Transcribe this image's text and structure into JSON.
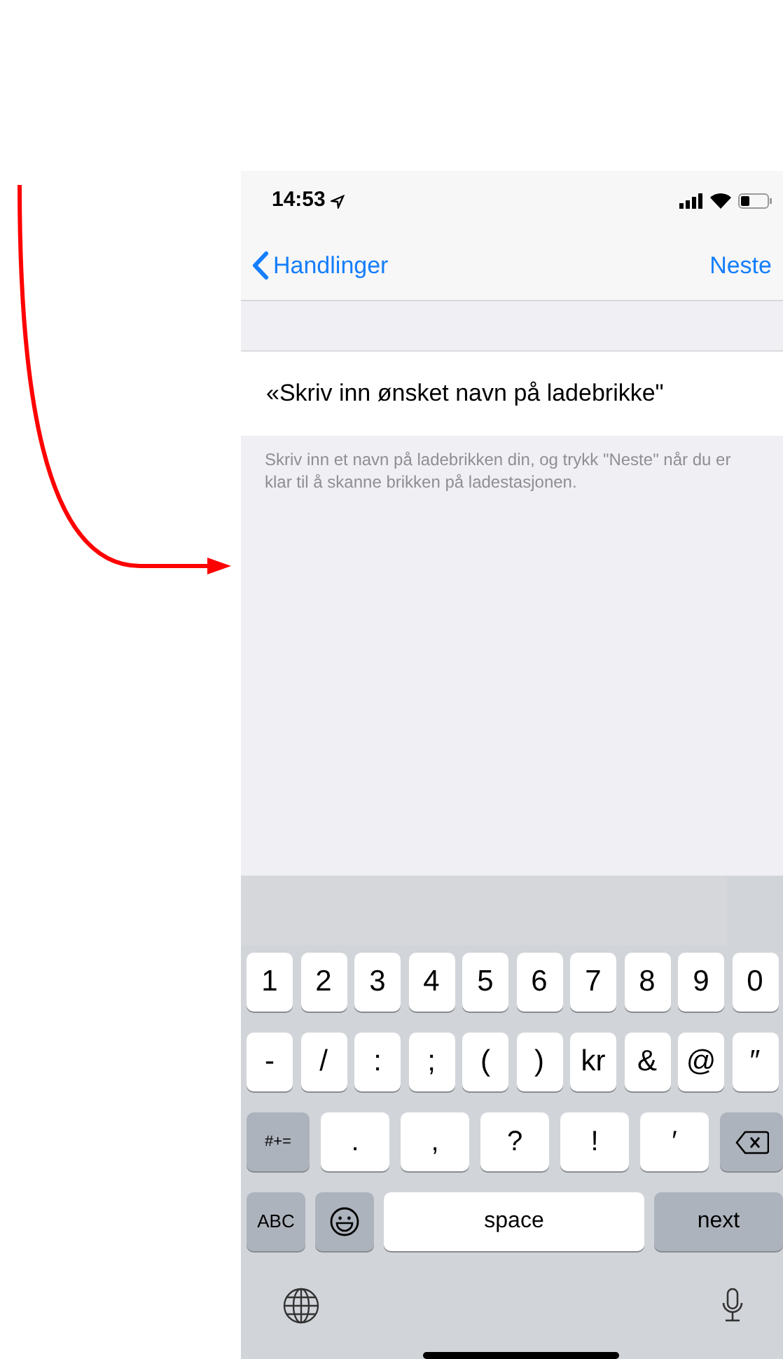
{
  "status_bar": {
    "time": "14:53"
  },
  "nav_bar": {
    "back_label": "Handlinger",
    "action": "Neste"
  },
  "name_field": {
    "value": "«Skriv inn ønsket navn på ladebrikke\""
  },
  "help_text": "Skriv inn et navn på ladebrikken din, og trykk \"Neste\" når du er klar til å skanne brikken på ladestasjonen.",
  "keyboard": {
    "rows": [
      {
        "keys": [
          {
            "kind": "char",
            "label": "1"
          },
          {
            "kind": "char",
            "label": "2"
          },
          {
            "kind": "char",
            "label": "3"
          },
          {
            "kind": "char",
            "label": "4"
          },
          {
            "kind": "char",
            "label": "5"
          },
          {
            "kind": "char",
            "label": "6"
          },
          {
            "kind": "char",
            "label": "7"
          },
          {
            "kind": "char",
            "label": "8"
          },
          {
            "kind": "char",
            "label": "9"
          },
          {
            "kind": "char",
            "label": "0"
          }
        ]
      },
      {
        "keys": [
          {
            "kind": "char",
            "label": "-"
          },
          {
            "kind": "char",
            "label": "/"
          },
          {
            "kind": "char",
            "label": ":"
          },
          {
            "kind": "char",
            "label": ";"
          },
          {
            "kind": "char",
            "label": "("
          },
          {
            "kind": "char",
            "label": ")"
          },
          {
            "kind": "char",
            "label": "kr"
          },
          {
            "kind": "char",
            "label": "&"
          },
          {
            "kind": "char",
            "label": "@"
          },
          {
            "kind": "char",
            "label": "″"
          }
        ]
      },
      {
        "keys": [
          {
            "kind": "function",
            "label": "#+="
          },
          {
            "kind": "char",
            "label": "."
          },
          {
            "kind": "char",
            "label": ","
          },
          {
            "kind": "char",
            "label": "?"
          },
          {
            "kind": "char",
            "label": "!"
          },
          {
            "kind": "char",
            "label": "′"
          },
          {
            "kind": "delete"
          }
        ]
      },
      {
        "keys": [
          {
            "kind": "function",
            "label": "ABC"
          },
          {
            "kind": "emoji"
          },
          {
            "kind": "space",
            "label": "space"
          },
          {
            "kind": "function",
            "label": "next"
          }
        ]
      }
    ]
  }
}
